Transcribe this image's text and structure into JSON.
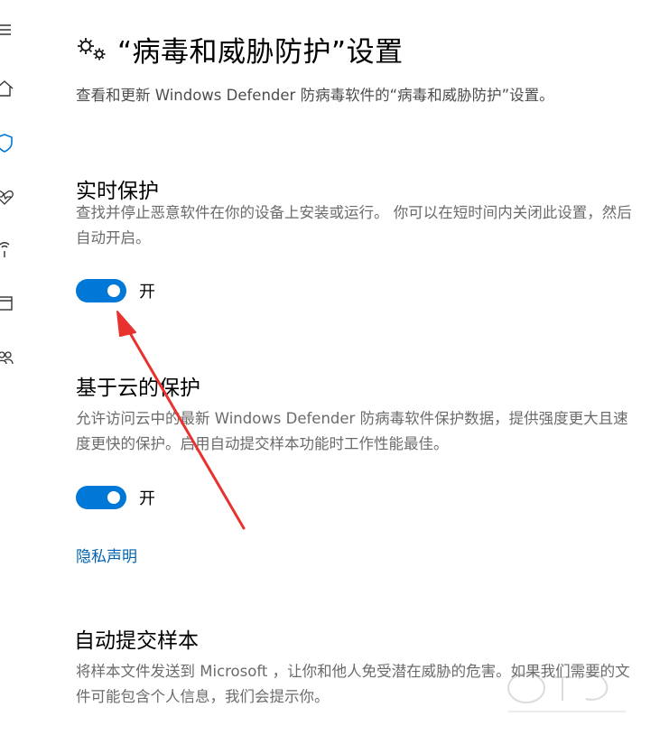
{
  "header": {
    "title": "“病毒和威胁防护”设置",
    "description": "查看和更新 Windows Defender 防病毒软件的“病毒和威胁防护”设置。"
  },
  "nav_icons": [
    "menu-icon",
    "home-icon",
    "shield-icon",
    "health-icon",
    "network-icon",
    "app-browser-icon",
    "family-icon"
  ],
  "sections": {
    "realtime": {
      "title": "实时保护",
      "description": "查找并停止恶意软件在你的设备上安装或运行。 你可以在短时间内关闭此设置，然后自动开启。",
      "toggle_label": "开"
    },
    "cloud": {
      "title": "基于云的保护",
      "description": "允许访问云中的最新 Windows Defender 防病毒软件保护数据，提供强度更大且速度更快的保护。启用自动提交样本功能时工作性能最佳。",
      "toggle_label": "开",
      "privacy_link": "隐私声明"
    },
    "sample": {
      "title": "自动提交样本",
      "description": "将样本文件发送到 Microsoft ，让你和他人免受潜在威胁的危害。如果我们需要的文件可能包含个人信息，我们会提示你。"
    }
  },
  "colors": {
    "accent": "#0078d7",
    "link": "#0063b1",
    "annotation_arrow": "#e8322f"
  }
}
